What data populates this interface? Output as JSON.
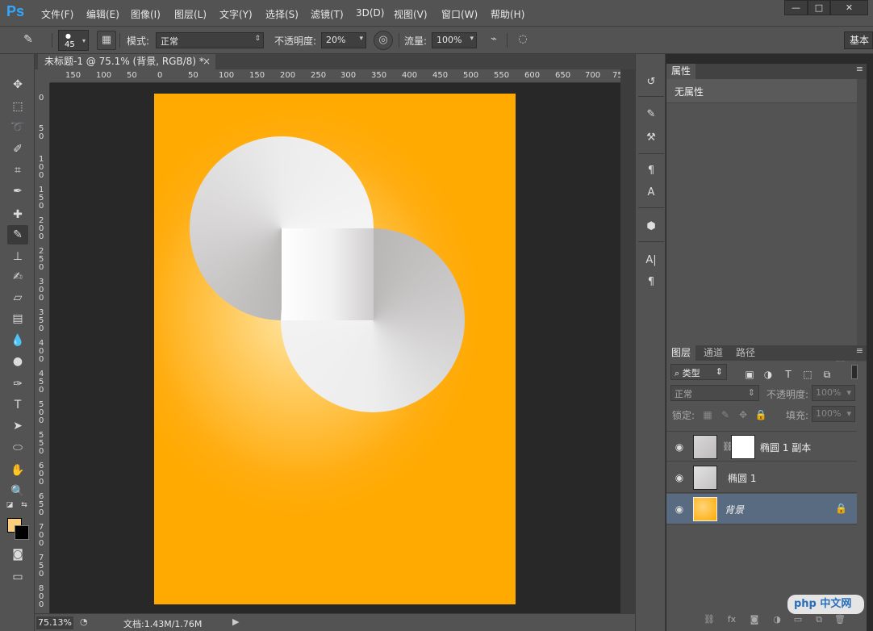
{
  "app": {
    "logo": "Ps"
  },
  "menu": [
    "文件(F)",
    "编辑(E)",
    "图像(I)",
    "图层(L)",
    "文字(Y)",
    "选择(S)",
    "滤镜(T)",
    "3D(D)",
    "视图(V)",
    "窗口(W)",
    "帮助(H)"
  ],
  "window_controls": {
    "minimize": "—",
    "maximize": "□",
    "close": "✕"
  },
  "options": {
    "brush_size": "45",
    "mode_label": "模式:",
    "mode_value": "正常",
    "opacity_label": "不透明度:",
    "opacity_value": "20%",
    "flow_label": "流量:",
    "flow_value": "100%",
    "workspace": "基本"
  },
  "document": {
    "tab_title": "未标题-1 @ 75.1% (背景, RGB/8) *",
    "close": "×",
    "ruler_top": [
      "150",
      "100",
      "50",
      "0",
      "50",
      "100",
      "150",
      "200",
      "250",
      "300",
      "350",
      "400",
      "450",
      "500",
      "550",
      "600",
      "650",
      "700",
      "75"
    ],
    "ruler_left": [
      "0",
      "5 0",
      "1 0 0",
      "1 5 0",
      "2 0 0",
      "2 5 0",
      "3 0 0",
      "3 5 0",
      "4 0 0",
      "4 5 0",
      "5 0 0",
      "5 5 0",
      "6 0 0",
      "6 5 0",
      "7 0 0",
      "7 5 0",
      "8 0 0"
    ],
    "colors": {
      "background": "#ffaa00",
      "highlight": "#ffe7a6",
      "circle": "#e6e5e5"
    }
  },
  "status": {
    "zoom": "75.13%",
    "doc_size": "文档:1.43M/1.76M"
  },
  "swatches": {
    "foreground": "#fdcd7e",
    "background": "#000000"
  },
  "properties_panel": {
    "tab": "属性",
    "title": "无属性"
  },
  "layers_panel": {
    "tabs": [
      "图层",
      "通道",
      "路径"
    ],
    "filter_label": "类型",
    "blend_mode": "正常",
    "opacity_label": "不透明度:",
    "opacity_value": "100%",
    "lock_label": "锁定:",
    "fill_label": "填充:",
    "fill_value": "100%",
    "layers": [
      {
        "name": "椭圆 1 副本",
        "selected": false
      },
      {
        "name": "椭圆 1",
        "selected": false
      },
      {
        "name": "背景",
        "selected": true
      }
    ]
  },
  "watermark": "php 中文网"
}
